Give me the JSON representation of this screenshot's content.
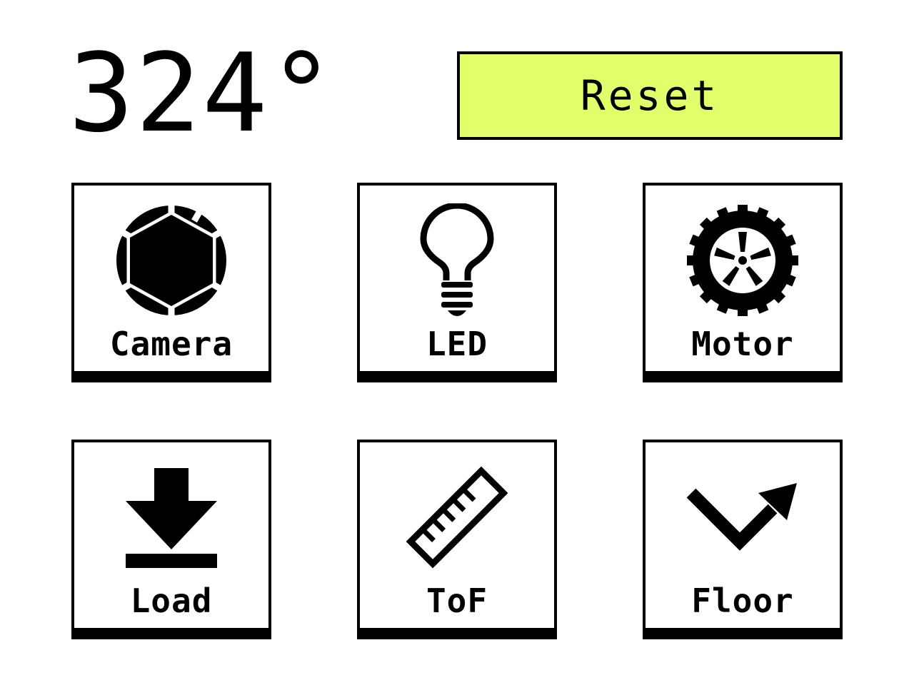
{
  "heading": {
    "value": "324°"
  },
  "reset": {
    "label": "Reset",
    "color": "#e0ff6a"
  },
  "tiles": [
    {
      "label": "Camera",
      "icon": "camera-aperture-icon"
    },
    {
      "label": "LED",
      "icon": "lightbulb-icon"
    },
    {
      "label": "Motor",
      "icon": "tire-wheel-icon"
    },
    {
      "label": "Load",
      "icon": "download-icon"
    },
    {
      "label": "ToF",
      "icon": "ruler-icon"
    },
    {
      "label": "Floor",
      "icon": "trend-arrow-icon"
    }
  ]
}
